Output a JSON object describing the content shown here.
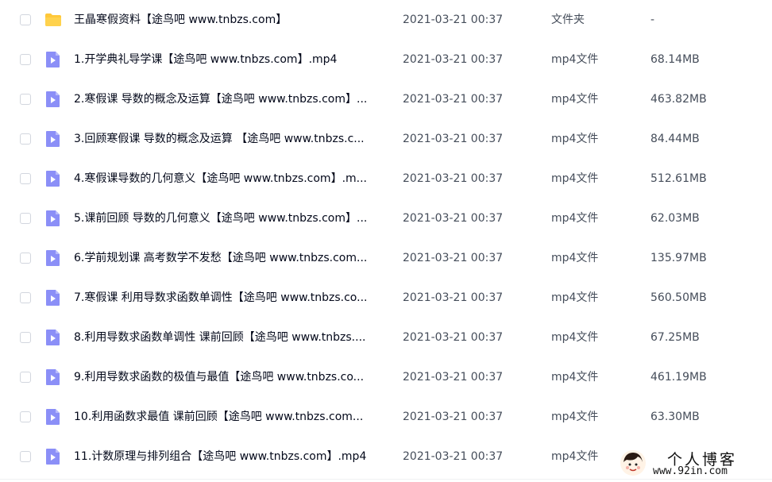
{
  "files": [
    {
      "name": "王晶寒假资料【途鸟吧 www.tnbzs.com】",
      "time": "2021-03-21 00:37",
      "type": "文件夹",
      "size": "-",
      "icon": "folder-icon",
      "icon_color": "#ffc83a"
    },
    {
      "name": "1.开学典礼导学课【途鸟吧 www.tnbzs.com】.mp4",
      "time": "2021-03-21 00:37",
      "type": "mp4文件",
      "size": "68.14MB",
      "icon": "video-file-icon",
      "icon_color": "#8b8ff7"
    },
    {
      "name": "2.寒假课 导数的概念及运算【途鸟吧 www.tnbzs.com】...",
      "time": "2021-03-21 00:37",
      "type": "mp4文件",
      "size": "463.82MB",
      "icon": "video-file-icon",
      "icon_color": "#8b8ff7"
    },
    {
      "name": "3.回顾寒假课 导数的概念及运算 【途鸟吧 www.tnbzs.c...",
      "time": "2021-03-21 00:37",
      "type": "mp4文件",
      "size": "84.44MB",
      "icon": "video-file-icon",
      "icon_color": "#8b8ff7"
    },
    {
      "name": "4.寒假课导数的几何意义【途鸟吧 www.tnbzs.com】.m...",
      "time": "2021-03-21 00:37",
      "type": "mp4文件",
      "size": "512.61MB",
      "icon": "video-file-icon",
      "icon_color": "#8b8ff7"
    },
    {
      "name": "5.课前回顾 导数的几何意义【途鸟吧 www.tnbzs.com】...",
      "time": "2021-03-21 00:37",
      "type": "mp4文件",
      "size": "62.03MB",
      "icon": "video-file-icon",
      "icon_color": "#8b8ff7"
    },
    {
      "name": "6.学前规划课 高考数学不发愁【途鸟吧 www.tnbzs.com...",
      "time": "2021-03-21 00:37",
      "type": "mp4文件",
      "size": "135.97MB",
      "icon": "video-file-icon",
      "icon_color": "#8b8ff7"
    },
    {
      "name": "7.寒假课 利用导数求函数单调性【途鸟吧 www.tnbzs.co...",
      "time": "2021-03-21 00:37",
      "type": "mp4文件",
      "size": "560.50MB",
      "icon": "video-file-icon",
      "icon_color": "#8b8ff7"
    },
    {
      "name": "8.利用导数求函数单调性 课前回顾【途鸟吧 www.tnbzs....",
      "time": "2021-03-21 00:37",
      "type": "mp4文件",
      "size": "67.25MB",
      "icon": "video-file-icon",
      "icon_color": "#8b8ff7"
    },
    {
      "name": "9.利用导数求函数的极值与最值【途鸟吧 www.tnbzs.co...",
      "time": "2021-03-21 00:37",
      "type": "mp4文件",
      "size": "461.19MB",
      "icon": "video-file-icon",
      "icon_color": "#8b8ff7"
    },
    {
      "name": "10.利用函数求最值 课前回顾【途鸟吧 www.tnbzs.com...",
      "time": "2021-03-21 00:37",
      "type": "mp4文件",
      "size": "63.30MB",
      "icon": "video-file-icon",
      "icon_color": "#8b8ff7"
    },
    {
      "name": "11.计数原理与排列组合【途鸟吧 www.tnbzs.com】.mp4",
      "time": "2021-03-21 00:37",
      "type": "mp4文件",
      "size": "",
      "icon": "video-file-icon",
      "icon_color": "#8b8ff7"
    }
  ],
  "watermark": {
    "title": "个人博客",
    "url": "www.92in.com"
  }
}
